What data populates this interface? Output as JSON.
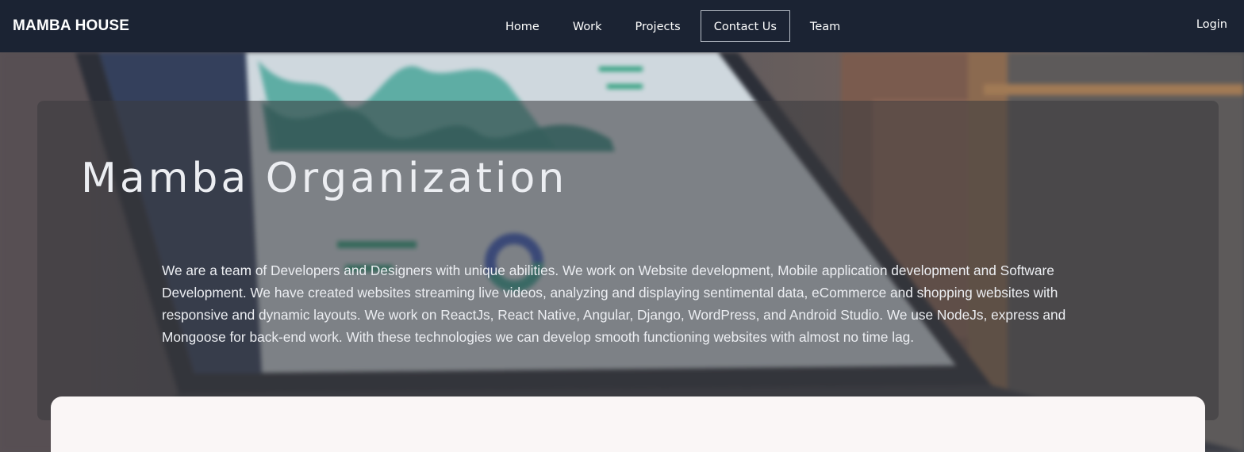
{
  "nav": {
    "brand": "MAMBA HOUSE",
    "links": [
      {
        "label": "Home",
        "active": false
      },
      {
        "label": "Work",
        "active": false
      },
      {
        "label": "Projects",
        "active": false
      },
      {
        "label": "Contact Us",
        "active": true
      },
      {
        "label": "Team",
        "active": false
      }
    ],
    "login": "Login"
  },
  "hero": {
    "title": "Mamba Organization",
    "description": "We are a team of Developers and Designers with unique abilities. We work on Website development, Mobile application development and Software Development. We have created websites streaming live videos, analyzing and displaying sentimental data, eCommerce and shopping websites with responsive and dynamic layouts. We work on ReactJs, React Native, Angular, Django, WordPress, and Android Studio. We use NodeJs, express and Mongoose for back-end work. With these technologies we can develop smooth functioning websites with almost no time lag."
  },
  "colors": {
    "navbar": "#1b2333",
    "card_overlay": "rgba(58,58,62,0.55)",
    "panel": "#faf6f6",
    "text": "#eceef2"
  }
}
